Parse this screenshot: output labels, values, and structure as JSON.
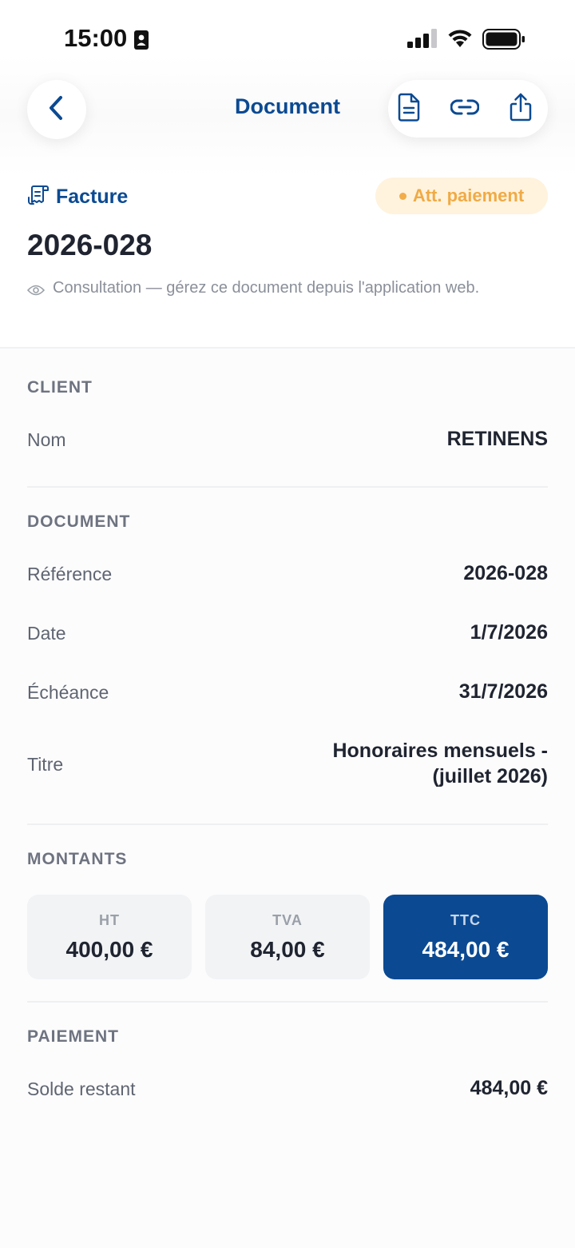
{
  "status_bar": {
    "time": "15:00",
    "icons": [
      "contact-card-icon",
      "signal-icon",
      "wifi-icon",
      "battery-icon"
    ]
  },
  "header": {
    "title": "Document",
    "back_icon": "chevron-left-icon",
    "actions": [
      "document-icon",
      "link-icon",
      "share-icon"
    ]
  },
  "document": {
    "type_label": "Facture",
    "type_icon": "invoice-icon",
    "status_badge": "Att. paiement",
    "number": "2026-028",
    "notice": "Consultation — gérez ce document depuis l'application web."
  },
  "sections": {
    "client": {
      "title": "CLIENT",
      "rows": [
        {
          "label": "Nom",
          "value": "RETINENS"
        }
      ]
    },
    "document": {
      "title": "DOCUMENT",
      "rows": [
        {
          "label": "Référence",
          "value": "2026-028"
        },
        {
          "label": "Date",
          "value": "1/7/2026"
        },
        {
          "label": "Échéance",
          "value": "31/7/2026"
        },
        {
          "label": "Titre",
          "value_line1": "Honoraires mensuels -",
          "value_line2": "(juillet 2026)"
        }
      ]
    },
    "montants": {
      "title": "MONTANTS",
      "cards": [
        {
          "label": "HT",
          "value": "400,00 €"
        },
        {
          "label": "TVA",
          "value": "84,00 €"
        },
        {
          "label": "TTC",
          "value": "484,00 €"
        }
      ]
    },
    "paiement": {
      "title": "PAIEMENT",
      "rows": [
        {
          "label": "Solde restant",
          "value": "484,00 €"
        }
      ]
    }
  },
  "colors": {
    "brand": "#0b4a92",
    "badge_bg": "#fff3de",
    "badge_text": "#f0aa45",
    "text_primary": "#1f2430",
    "text_secondary": "#6e7380"
  }
}
